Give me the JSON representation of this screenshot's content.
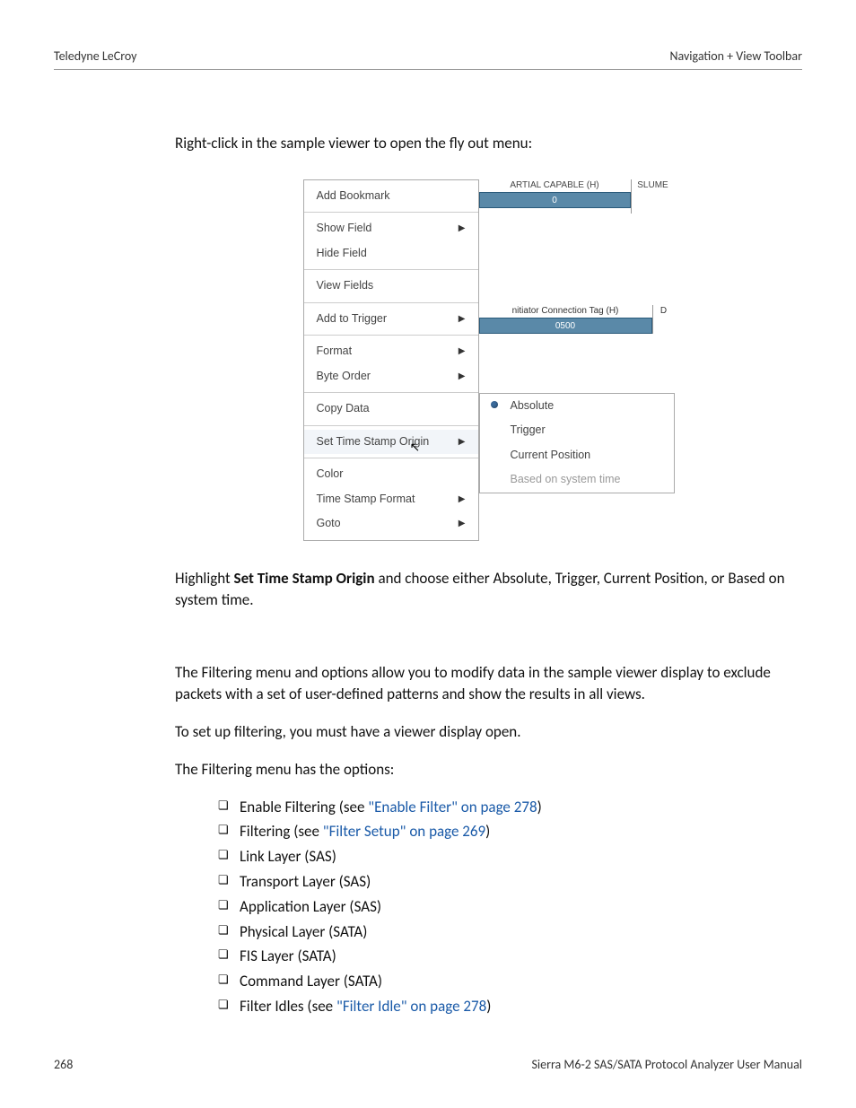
{
  "header": {
    "left": "Teledyne LeCroy",
    "right": "Navigation + View Toolbar"
  },
  "intro": "Right-click in the sample viewer to open the fly out menu:",
  "menu": {
    "g1": [
      "Add Bookmark"
    ],
    "g2": [
      "Show Field",
      "Hide Field"
    ],
    "g3": [
      "View Fields"
    ],
    "g4": [
      "Add to Trigger"
    ],
    "g5": [
      "Format",
      "Byte Order"
    ],
    "g6": [
      "Copy Data"
    ],
    "g7": [
      "Set Time Stamp Origin"
    ],
    "g8": [
      "Color",
      "Time Stamp Format",
      "Goto"
    ]
  },
  "bgTop": {
    "hdr1": "ARTIAL CAPABLE (H)",
    "val1": "0",
    "hdr2": "SLUME"
  },
  "bgMid": {
    "hdr1": "nitiator Connection Tag (H)",
    "val1": "0500",
    "hdr2": "D"
  },
  "submenu": {
    "absolute": "Absolute",
    "trigger": "Trigger",
    "current": "Current Position",
    "system": "Based on system time"
  },
  "afterFig": {
    "pre": "Highlight ",
    "bold": "Set Time Stamp Origin",
    "post": " and choose either Absolute, Trigger, Current Position, or Based on system time."
  },
  "filtering": {
    "p1": "The Filtering menu and options allow you to modify data in the sample viewer display to exclude packets with a set of user-defined patterns and show the results in all views.",
    "p2": "To set up filtering, you must have a viewer display open.",
    "p3": "The Filtering menu has the options:"
  },
  "list": {
    "i1a": "Enable Filtering (see ",
    "i1b": "\"Enable Filter\" on page 278",
    "i1c": ")",
    "i2a": "Filtering (see ",
    "i2b": "\"Filter Setup\" on page 269",
    "i2c": ")",
    "i3": "Link Layer (SAS)",
    "i4": "Transport Layer (SAS)",
    "i5": "Application Layer (SAS)",
    "i6": "Physical Layer (SATA)",
    "i7": "FIS Layer (SATA)",
    "i8": "Command Layer (SATA)",
    "i9a": "Filter Idles (see ",
    "i9b": "\"Filter Idle\" on page 278",
    "i9c": ")"
  },
  "footer": {
    "left": "268",
    "right": "Sierra M6-2 SAS/SATA Protocol Analyzer User Manual"
  }
}
